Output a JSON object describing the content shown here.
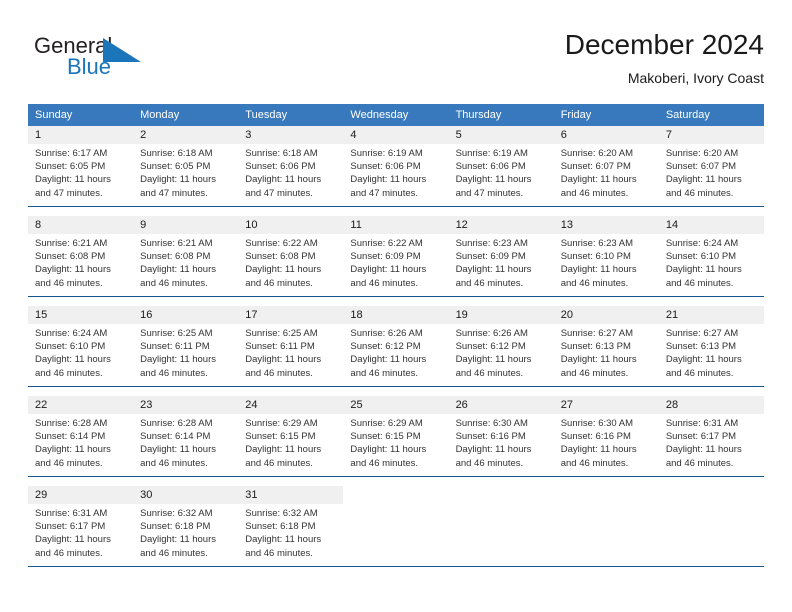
{
  "logo": {
    "word_top": "General",
    "word_bottom": "Blue",
    "triangle_color": "#1b75bb",
    "top_color": "#231f20"
  },
  "header": {
    "title": "December 2024",
    "subtitle": "Makoberi, Ivory Coast"
  },
  "colors": {
    "header_bg": "#3879bd",
    "header_text": "#ffffff",
    "daynum_bg": "#f0f0f0",
    "separator": "#14558f",
    "body_text": "#333333"
  },
  "weekday_headers": [
    "Sunday",
    "Monday",
    "Tuesday",
    "Wednesday",
    "Thursday",
    "Friday",
    "Saturday"
  ],
  "labels": {
    "sunrise_prefix": "Sunrise:",
    "sunset_prefix": "Sunset:",
    "daylight_prefix": "Daylight:"
  },
  "weeks": [
    {
      "days": [
        {
          "num": "1",
          "sunrise": "Sunrise: 6:17 AM",
          "sunset": "Sunset: 6:05 PM",
          "daylight_1": "Daylight: 11 hours",
          "daylight_2": "and 47 minutes."
        },
        {
          "num": "2",
          "sunrise": "Sunrise: 6:18 AM",
          "sunset": "Sunset: 6:05 PM",
          "daylight_1": "Daylight: 11 hours",
          "daylight_2": "and 47 minutes."
        },
        {
          "num": "3",
          "sunrise": "Sunrise: 6:18 AM",
          "sunset": "Sunset: 6:06 PM",
          "daylight_1": "Daylight: 11 hours",
          "daylight_2": "and 47 minutes."
        },
        {
          "num": "4",
          "sunrise": "Sunrise: 6:19 AM",
          "sunset": "Sunset: 6:06 PM",
          "daylight_1": "Daylight: 11 hours",
          "daylight_2": "and 47 minutes."
        },
        {
          "num": "5",
          "sunrise": "Sunrise: 6:19 AM",
          "sunset": "Sunset: 6:06 PM",
          "daylight_1": "Daylight: 11 hours",
          "daylight_2": "and 47 minutes."
        },
        {
          "num": "6",
          "sunrise": "Sunrise: 6:20 AM",
          "sunset": "Sunset: 6:07 PM",
          "daylight_1": "Daylight: 11 hours",
          "daylight_2": "and 46 minutes."
        },
        {
          "num": "7",
          "sunrise": "Sunrise: 6:20 AM",
          "sunset": "Sunset: 6:07 PM",
          "daylight_1": "Daylight: 11 hours",
          "daylight_2": "and 46 minutes."
        }
      ]
    },
    {
      "days": [
        {
          "num": "8",
          "sunrise": "Sunrise: 6:21 AM",
          "sunset": "Sunset: 6:08 PM",
          "daylight_1": "Daylight: 11 hours",
          "daylight_2": "and 46 minutes."
        },
        {
          "num": "9",
          "sunrise": "Sunrise: 6:21 AM",
          "sunset": "Sunset: 6:08 PM",
          "daylight_1": "Daylight: 11 hours",
          "daylight_2": "and 46 minutes."
        },
        {
          "num": "10",
          "sunrise": "Sunrise: 6:22 AM",
          "sunset": "Sunset: 6:08 PM",
          "daylight_1": "Daylight: 11 hours",
          "daylight_2": "and 46 minutes."
        },
        {
          "num": "11",
          "sunrise": "Sunrise: 6:22 AM",
          "sunset": "Sunset: 6:09 PM",
          "daylight_1": "Daylight: 11 hours",
          "daylight_2": "and 46 minutes."
        },
        {
          "num": "12",
          "sunrise": "Sunrise: 6:23 AM",
          "sunset": "Sunset: 6:09 PM",
          "daylight_1": "Daylight: 11 hours",
          "daylight_2": "and 46 minutes."
        },
        {
          "num": "13",
          "sunrise": "Sunrise: 6:23 AM",
          "sunset": "Sunset: 6:10 PM",
          "daylight_1": "Daylight: 11 hours",
          "daylight_2": "and 46 minutes."
        },
        {
          "num": "14",
          "sunrise": "Sunrise: 6:24 AM",
          "sunset": "Sunset: 6:10 PM",
          "daylight_1": "Daylight: 11 hours",
          "daylight_2": "and 46 minutes."
        }
      ]
    },
    {
      "days": [
        {
          "num": "15",
          "sunrise": "Sunrise: 6:24 AM",
          "sunset": "Sunset: 6:10 PM",
          "daylight_1": "Daylight: 11 hours",
          "daylight_2": "and 46 minutes."
        },
        {
          "num": "16",
          "sunrise": "Sunrise: 6:25 AM",
          "sunset": "Sunset: 6:11 PM",
          "daylight_1": "Daylight: 11 hours",
          "daylight_2": "and 46 minutes."
        },
        {
          "num": "17",
          "sunrise": "Sunrise: 6:25 AM",
          "sunset": "Sunset: 6:11 PM",
          "daylight_1": "Daylight: 11 hours",
          "daylight_2": "and 46 minutes."
        },
        {
          "num": "18",
          "sunrise": "Sunrise: 6:26 AM",
          "sunset": "Sunset: 6:12 PM",
          "daylight_1": "Daylight: 11 hours",
          "daylight_2": "and 46 minutes."
        },
        {
          "num": "19",
          "sunrise": "Sunrise: 6:26 AM",
          "sunset": "Sunset: 6:12 PM",
          "daylight_1": "Daylight: 11 hours",
          "daylight_2": "and 46 minutes."
        },
        {
          "num": "20",
          "sunrise": "Sunrise: 6:27 AM",
          "sunset": "Sunset: 6:13 PM",
          "daylight_1": "Daylight: 11 hours",
          "daylight_2": "and 46 minutes."
        },
        {
          "num": "21",
          "sunrise": "Sunrise: 6:27 AM",
          "sunset": "Sunset: 6:13 PM",
          "daylight_1": "Daylight: 11 hours",
          "daylight_2": "and 46 minutes."
        }
      ]
    },
    {
      "days": [
        {
          "num": "22",
          "sunrise": "Sunrise: 6:28 AM",
          "sunset": "Sunset: 6:14 PM",
          "daylight_1": "Daylight: 11 hours",
          "daylight_2": "and 46 minutes."
        },
        {
          "num": "23",
          "sunrise": "Sunrise: 6:28 AM",
          "sunset": "Sunset: 6:14 PM",
          "daylight_1": "Daylight: 11 hours",
          "daylight_2": "and 46 minutes."
        },
        {
          "num": "24",
          "sunrise": "Sunrise: 6:29 AM",
          "sunset": "Sunset: 6:15 PM",
          "daylight_1": "Daylight: 11 hours",
          "daylight_2": "and 46 minutes."
        },
        {
          "num": "25",
          "sunrise": "Sunrise: 6:29 AM",
          "sunset": "Sunset: 6:15 PM",
          "daylight_1": "Daylight: 11 hours",
          "daylight_2": "and 46 minutes."
        },
        {
          "num": "26",
          "sunrise": "Sunrise: 6:30 AM",
          "sunset": "Sunset: 6:16 PM",
          "daylight_1": "Daylight: 11 hours",
          "daylight_2": "and 46 minutes."
        },
        {
          "num": "27",
          "sunrise": "Sunrise: 6:30 AM",
          "sunset": "Sunset: 6:16 PM",
          "daylight_1": "Daylight: 11 hours",
          "daylight_2": "and 46 minutes."
        },
        {
          "num": "28",
          "sunrise": "Sunrise: 6:31 AM",
          "sunset": "Sunset: 6:17 PM",
          "daylight_1": "Daylight: 11 hours",
          "daylight_2": "and 46 minutes."
        }
      ]
    },
    {
      "days": [
        {
          "num": "29",
          "sunrise": "Sunrise: 6:31 AM",
          "sunset": "Sunset: 6:17 PM",
          "daylight_1": "Daylight: 11 hours",
          "daylight_2": "and 46 minutes."
        },
        {
          "num": "30",
          "sunrise": "Sunrise: 6:32 AM",
          "sunset": "Sunset: 6:18 PM",
          "daylight_1": "Daylight: 11 hours",
          "daylight_2": "and 46 minutes."
        },
        {
          "num": "31",
          "sunrise": "Sunrise: 6:32 AM",
          "sunset": "Sunset: 6:18 PM",
          "daylight_1": "Daylight: 11 hours",
          "daylight_2": "and 46 minutes."
        },
        {
          "num": "",
          "sunrise": "",
          "sunset": "",
          "daylight_1": "",
          "daylight_2": ""
        },
        {
          "num": "",
          "sunrise": "",
          "sunset": "",
          "daylight_1": "",
          "daylight_2": ""
        },
        {
          "num": "",
          "sunrise": "",
          "sunset": "",
          "daylight_1": "",
          "daylight_2": ""
        },
        {
          "num": "",
          "sunrise": "",
          "sunset": "",
          "daylight_1": "",
          "daylight_2": ""
        }
      ]
    }
  ]
}
